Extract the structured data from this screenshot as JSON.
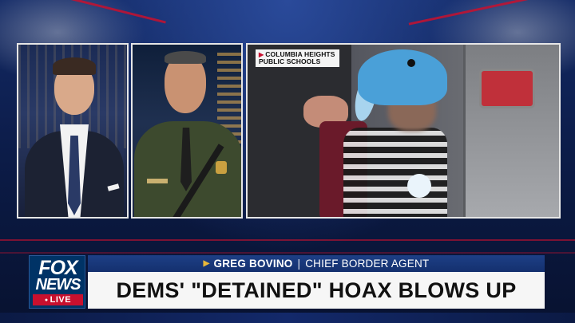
{
  "video": {
    "source_label_line1": "COLUMBIA HEIGHTS",
    "source_label_line2": "PUBLIC SCHOOLS"
  },
  "lower_third": {
    "guest_name": "GREG BOVINO",
    "guest_title": "CHIEF BORDER AGENT",
    "separator": "|",
    "headline": "DEMS' \"DETAINED\" HOAX BLOWS UP"
  },
  "logo": {
    "line1": "FOX",
    "line2": "NEWS",
    "live": "LIVE"
  },
  "colors": {
    "nameplate_blue": "#1d3f86",
    "live_red": "#c8102e",
    "logo_navy": "#003366",
    "headline_bg": "#f6f6f6"
  }
}
